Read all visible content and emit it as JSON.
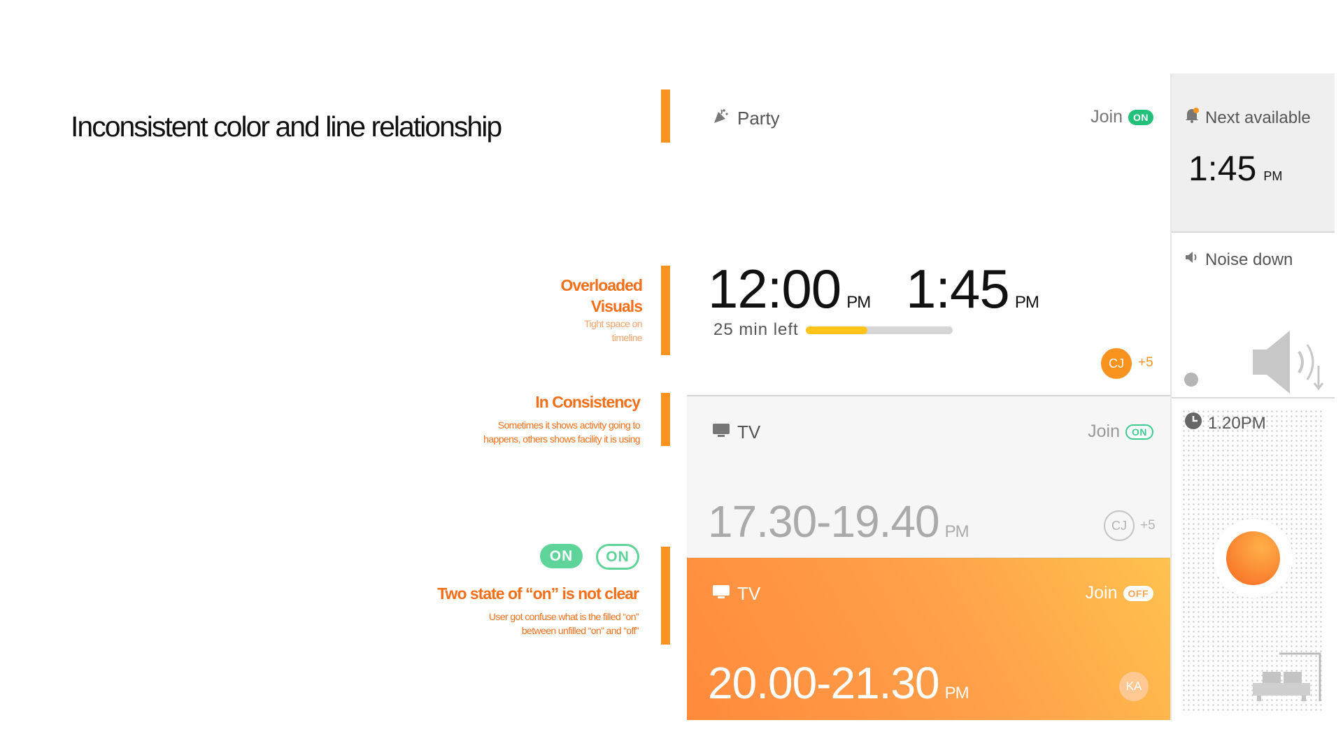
{
  "page_title": "Inconsistent color and line relationship",
  "annotations": {
    "overloaded": {
      "title_line1": "Overloaded",
      "title_line2": "Visuals",
      "desc_line1": "Tight space on",
      "desc_line2": "timeline"
    },
    "consistency": {
      "title": "In Consistency",
      "desc_line1": "Sometimes it shows activity going to",
      "desc_line2": "happens, others shows facility it is using"
    },
    "two_state": {
      "pill_filled": "ON",
      "pill_outline": "ON",
      "title": "Two state of “on” is not clear",
      "desc_line1": "User got confuse what is the filled “on”",
      "desc_line2": "between unfilled “on” and “off”"
    }
  },
  "cards": {
    "party": {
      "icon": "party-popper-icon",
      "title": "Party",
      "join_label": "Join",
      "badge": "ON",
      "start_time": "12:00",
      "start_period": "PM",
      "end_time": "1:45",
      "end_period": "PM",
      "remaining": "25 min left",
      "progress": 0.42,
      "avatar": "CJ",
      "extra": "+5"
    },
    "tv1": {
      "icon": "tv-icon",
      "title": "TV",
      "join_label": "Join",
      "badge": "ON",
      "time_range": "17.30-19.40",
      "period": "PM",
      "avatar": "CJ",
      "extra": "+5"
    },
    "tv2": {
      "icon": "tv-icon",
      "title": "TV",
      "join_label": "Join",
      "badge": "OFF",
      "time_range": "20.00-21.30",
      "period": "PM",
      "avatar": "KA"
    }
  },
  "side": {
    "next": {
      "icon": "bell-icon",
      "label": "Next available",
      "time": "1:45",
      "period": "PM"
    },
    "noise": {
      "icon": "speaker-icon",
      "label": "Noise down"
    },
    "timer": {
      "icon": "clock-icon",
      "label": "1.20PM"
    }
  },
  "colors": {
    "accent_orange": "#f7931e",
    "on_green": "#3dcc8e",
    "progress_yellow": "#ffc41a"
  }
}
